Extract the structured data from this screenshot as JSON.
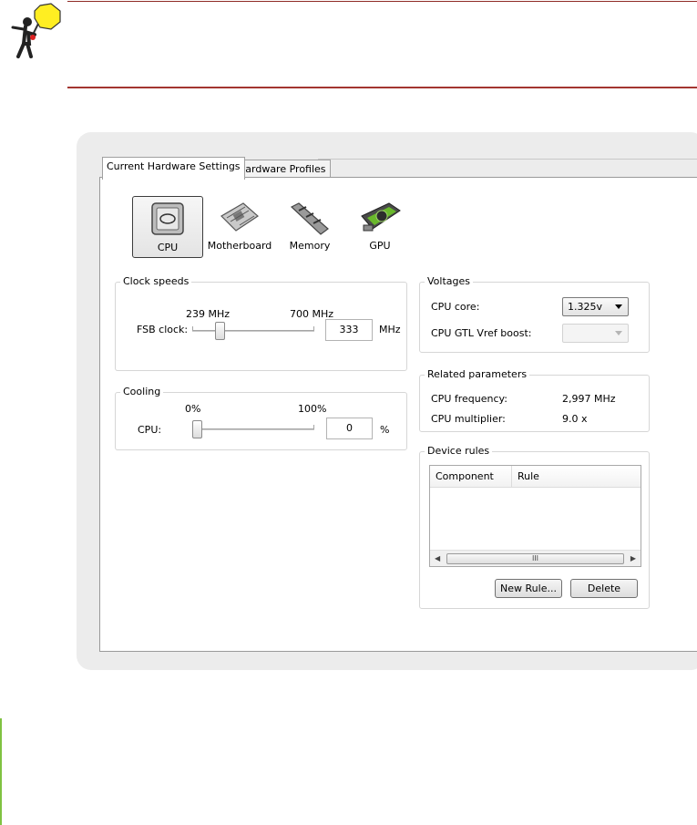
{
  "tabs": [
    {
      "label": "Current Hardware Settings",
      "active": true
    },
    {
      "label": "Hardware Profiles",
      "active": false
    }
  ],
  "devices": [
    {
      "label": "CPU",
      "icon": "cpu-icon",
      "selected": true
    },
    {
      "label": "Motherboard",
      "icon": "motherboard-icon",
      "selected": false
    },
    {
      "label": "Memory",
      "icon": "memory-icon",
      "selected": false
    },
    {
      "label": "GPU",
      "icon": "gpu-icon",
      "selected": false
    }
  ],
  "clock_speeds": {
    "title": "Clock speeds",
    "min_label": "239 MHz",
    "max_label": "700 MHz",
    "fsb_label": "FSB clock:",
    "fsb_value": "333",
    "unit": "MHz",
    "slider_fraction": 0.2
  },
  "cooling": {
    "title": "Cooling",
    "min_label": "0%",
    "max_label": "100%",
    "cpu_label": "CPU:",
    "cpu_value": "0",
    "unit": "%",
    "slider_fraction": 0.0
  },
  "voltages": {
    "title": "Voltages",
    "cpu_core_label": "CPU core:",
    "cpu_core_value": "1.325v",
    "gtl_label": "CPU GTL Vref boost:",
    "gtl_value": ""
  },
  "related": {
    "title": "Related parameters",
    "freq_label": "CPU frequency:",
    "freq_value": "2,997 MHz",
    "mult_label": "CPU multiplier:",
    "mult_value": "9.0 x"
  },
  "device_rules": {
    "title": "Device rules",
    "columns": [
      "Component",
      "Rule"
    ],
    "scroll_grip": "III",
    "new_rule_label": "New Rule...",
    "delete_label": "Delete"
  },
  "colors": {
    "note_rule": "#a33631",
    "side_bar": "#7fc241",
    "frame_bg": "#ececec"
  }
}
